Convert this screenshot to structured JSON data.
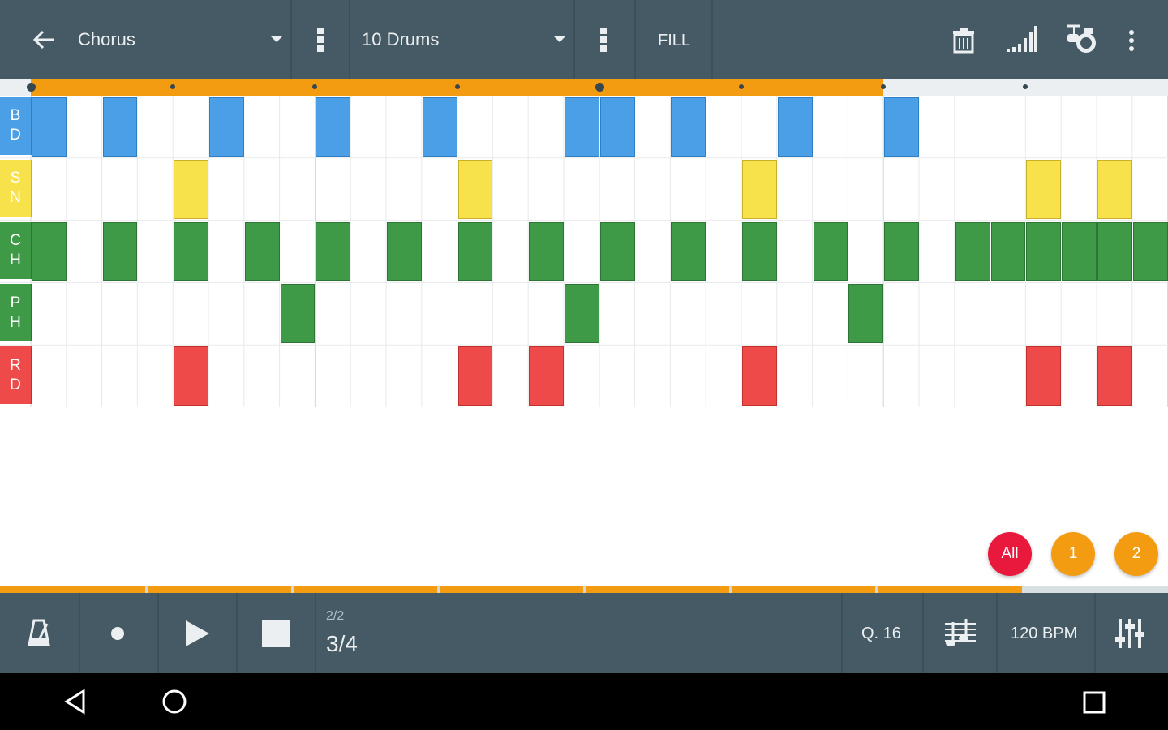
{
  "topbar": {
    "pattern_name": "Chorus",
    "kit_name": "10 Drums",
    "fill_label": "FILL"
  },
  "tracks": [
    {
      "letters": [
        "B",
        "D"
      ],
      "color": "#4a9fe6",
      "border": "#2f7fc4"
    },
    {
      "letters": [
        "S",
        "N"
      ],
      "color": "#f7e24b",
      "border": "#c9b22a"
    },
    {
      "letters": [
        "C",
        "H"
      ],
      "color": "#3f9a48",
      "border": "#2d7534"
    },
    {
      "letters": [
        "P",
        "H"
      ],
      "color": "#3f9a48",
      "border": "#2d7534"
    },
    {
      "letters": [
        "R",
        "D"
      ],
      "color": "#ef4a4a",
      "border": "#c0302f"
    }
  ],
  "pattern": {
    "steps": 32,
    "timeline_progress_steps": 24,
    "bd": [
      0,
      2,
      5,
      8,
      11,
      15,
      16,
      18,
      21,
      24
    ],
    "sn": [
      4,
      12,
      20,
      28,
      30
    ],
    "ch": [
      0,
      2,
      4,
      6,
      8,
      10,
      12,
      14,
      16,
      18,
      20,
      22,
      24,
      26,
      27,
      28,
      29,
      30,
      31
    ],
    "ph": [
      7,
      15,
      23
    ],
    "rd": [
      4,
      12,
      14,
      20,
      28,
      30
    ]
  },
  "pattern_buttons": [
    {
      "label": "All",
      "color": "#e8193c"
    },
    {
      "label": "1",
      "color": "#f39c12"
    },
    {
      "label": "2",
      "color": "#f39c12"
    }
  ],
  "transport": {
    "bar_position": "2/2",
    "time_signature": "3/4",
    "quantize": "Q. 16",
    "tempo": "120 BPM",
    "song_progress": 0.875
  },
  "colors": {
    "bar": "#455a64",
    "accent": "#f39c12"
  }
}
